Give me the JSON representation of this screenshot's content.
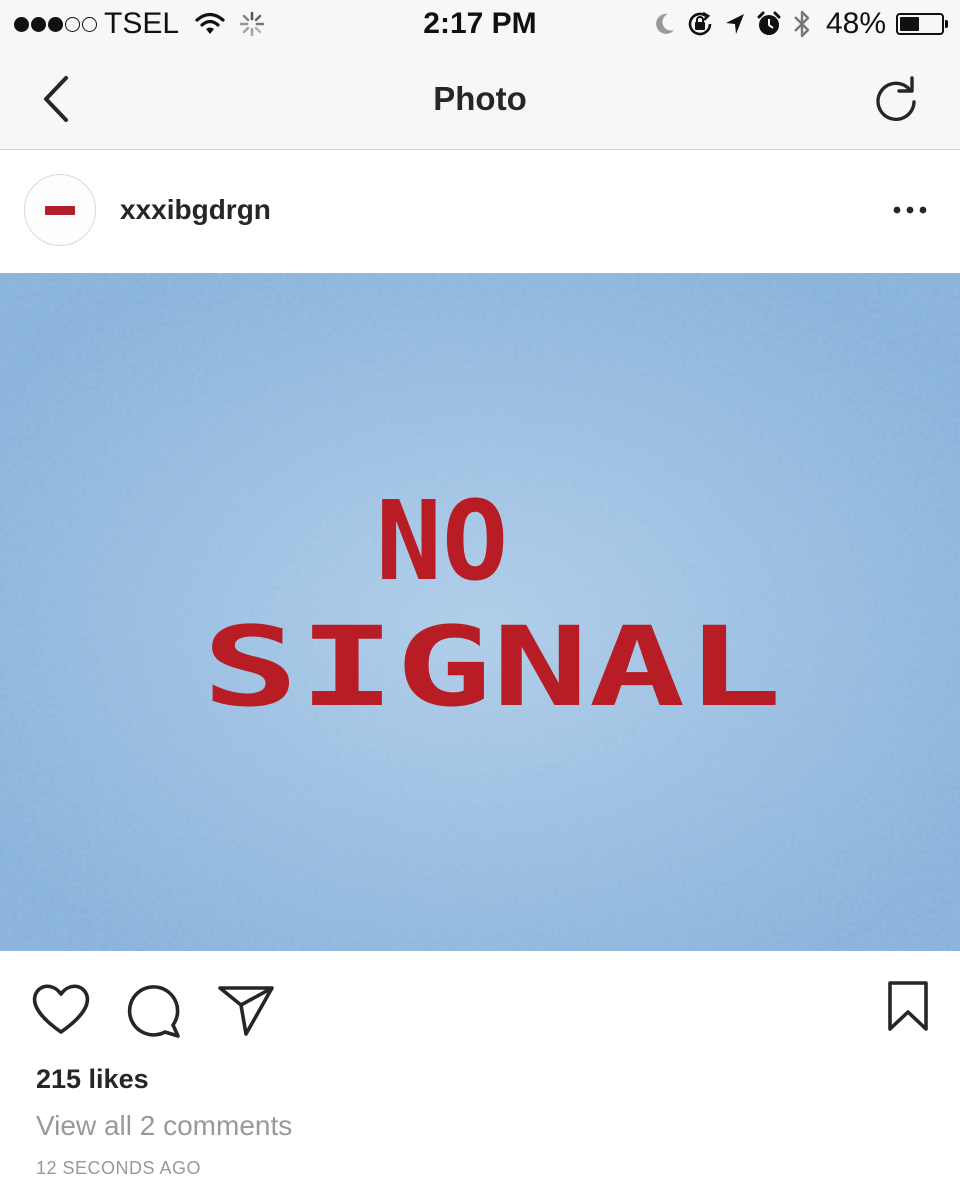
{
  "status_bar": {
    "carrier": "TSEL",
    "signal_bars_filled": 3,
    "signal_bars_total": 5,
    "time": "2:17 PM",
    "battery_percent": "48%",
    "battery_level": 0.48,
    "icons": [
      "wifi-icon",
      "loading-spinner-icon",
      "moon-icon",
      "rotation-lock-icon",
      "location-arrow-icon",
      "alarm-icon",
      "bluetooth-icon",
      "battery-icon"
    ]
  },
  "nav": {
    "title": "Photo",
    "back_icon": "chevron-left-icon",
    "refresh_icon": "refresh-icon"
  },
  "post": {
    "username": "xxxibgdrgn",
    "more_icon": "more-horizontal-icon",
    "image": {
      "line1": "NO",
      "line2": "SIGNAL",
      "text_color": "#b81c25",
      "static_color": "#6f9fcc"
    },
    "actions": {
      "like_icon": "heart-icon",
      "comment_icon": "comment-icon",
      "share_icon": "send-icon",
      "save_icon": "bookmark-icon"
    },
    "likes": "215 likes",
    "comments_link": "View all 2 comments",
    "timestamp": "12 SECONDS AGO"
  }
}
